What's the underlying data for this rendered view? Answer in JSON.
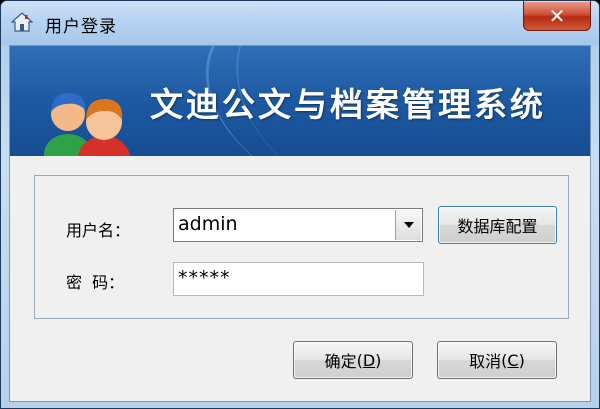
{
  "window": {
    "title": "用户登录",
    "close_symbol": "✕",
    "app_icon": "house-icon"
  },
  "banner": {
    "product_title": "文迪公文与档案管理系统",
    "icon": "users-icon"
  },
  "form": {
    "username_label": "用户名：",
    "username_value": "admin",
    "password_label": "密  码：",
    "password_value": "*****",
    "db_config_button": "数据库配置"
  },
  "actions": {
    "ok_label": "确定",
    "ok_mnemonic": "D",
    "cancel_label": "取消",
    "cancel_mnemonic": "C"
  },
  "colors": {
    "banner_blue": "#1d59a2",
    "close_red": "#c8412a",
    "titlebar": "#b6d2f0"
  }
}
